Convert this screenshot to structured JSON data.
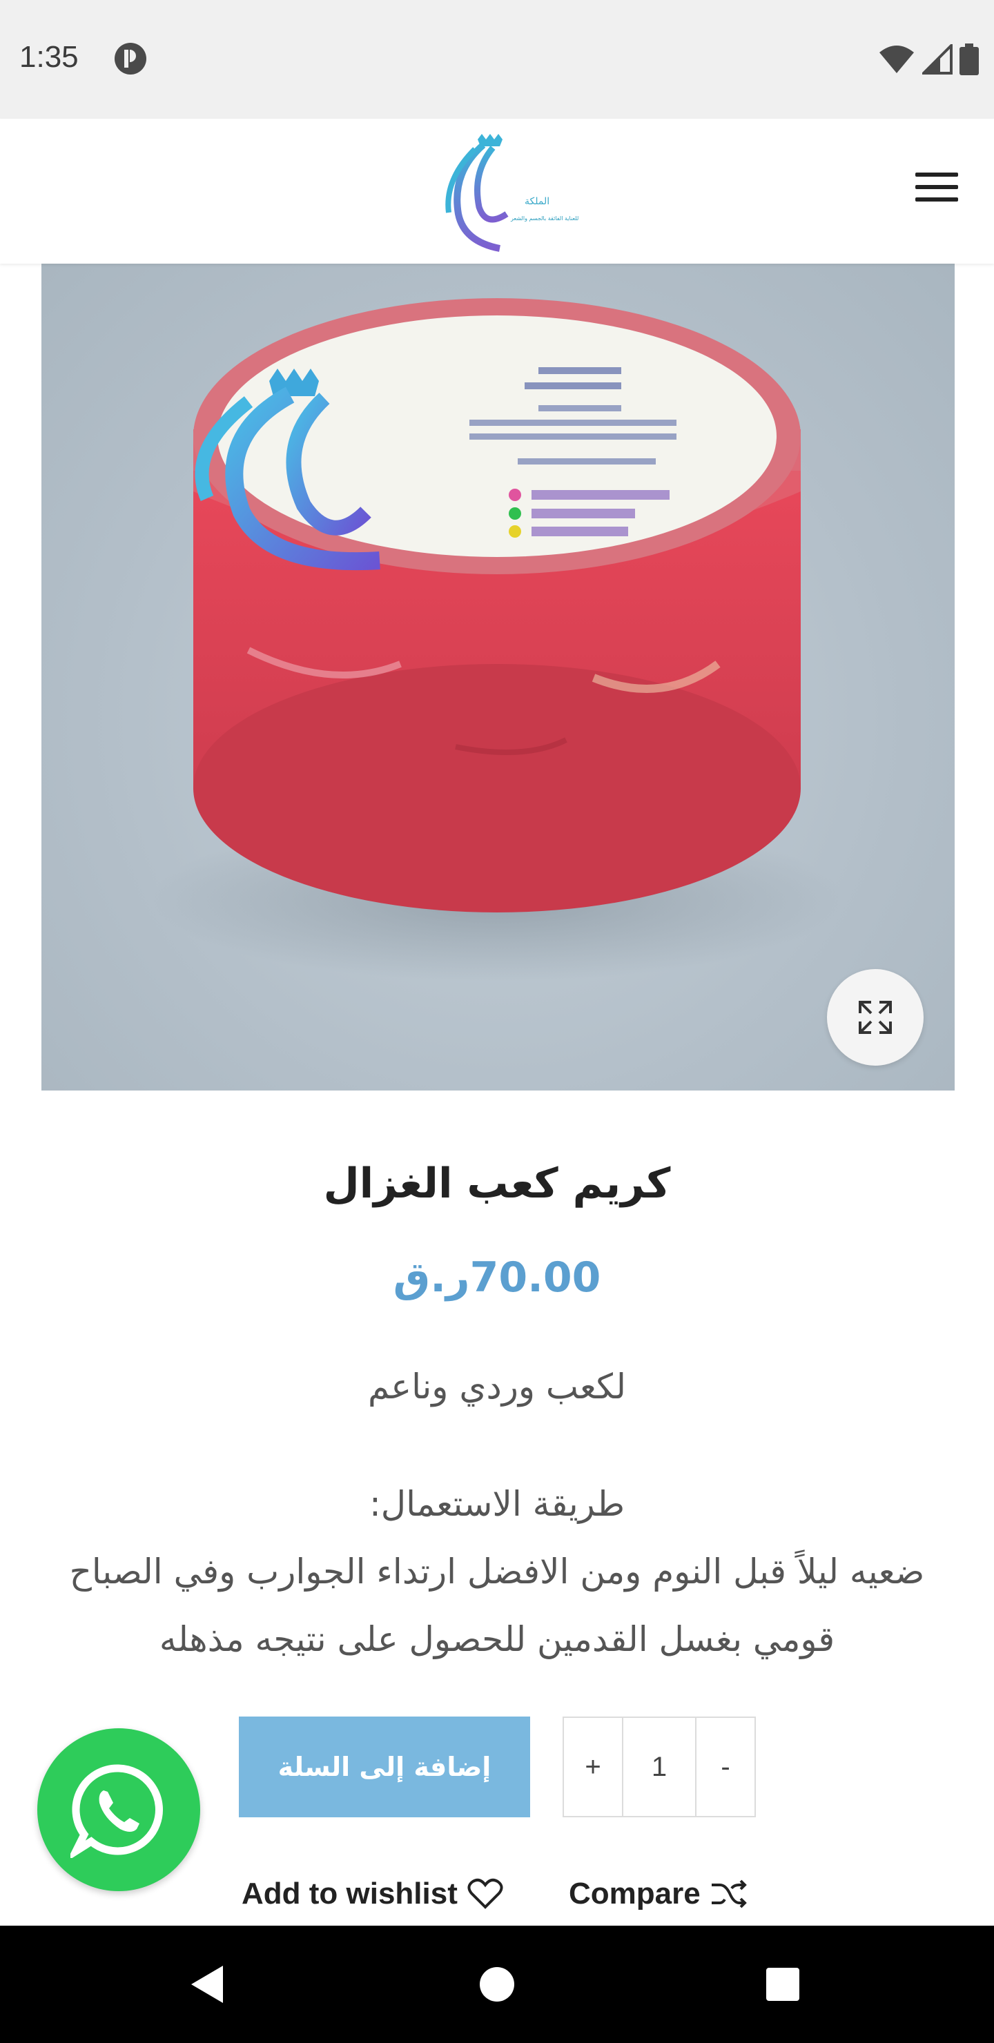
{
  "status_bar": {
    "time": "1:35",
    "icons": [
      "app-notification-icon",
      "wifi-icon",
      "cell-signal-icon",
      "battery-icon"
    ]
  },
  "header": {
    "logo_name": "الملكة",
    "logo_tagline": "للعناية الفائقة بالجسم والشعر",
    "menu_icon": "hamburger-menu-icon"
  },
  "product_image": {
    "label_lines": [
      "كريم كعب الغزال",
      "لكعب وردي وناعم",
      "طريقة الاستعمال:",
      "ضعيه ليلاً قبل النوم ومن الافضل ارتداء الجوارب وفي",
      "الصباح قومي بغسل القدمين للحصول على نتيجه مذهله",
      "ملاحظه / يحفظ في مكان بارد"
    ],
    "label_contacts": [
      "The_queenqtr",
      "30004401",
      "m_shmrq"
    ],
    "zoom_icon": "expand-icon"
  },
  "product": {
    "title": "كريم كعب الغزال",
    "price": "70.00ر.ق",
    "tagline": "لكعب وردي وناعم",
    "usage_title": "طريقة الاستعمال:",
    "usage_line1": "ضعيه ليلاً قبل النوم ومن الافضل ارتداء الجوارب وفي الصباح",
    "usage_line2": "قومي بغسل القدمين للحصول على نتيجه مذهله"
  },
  "cart": {
    "add_to_cart_label": "إضافة إلى السلة",
    "quantity": "1",
    "plus_label": "+",
    "minus_label": "-"
  },
  "actions": {
    "wishlist_label": "Add to wishlist",
    "compare_label": "Compare"
  },
  "colors": {
    "price": "#5b9fd0",
    "add_to_cart_bg": "#7ab8df",
    "whatsapp": "#2ecc5a"
  }
}
